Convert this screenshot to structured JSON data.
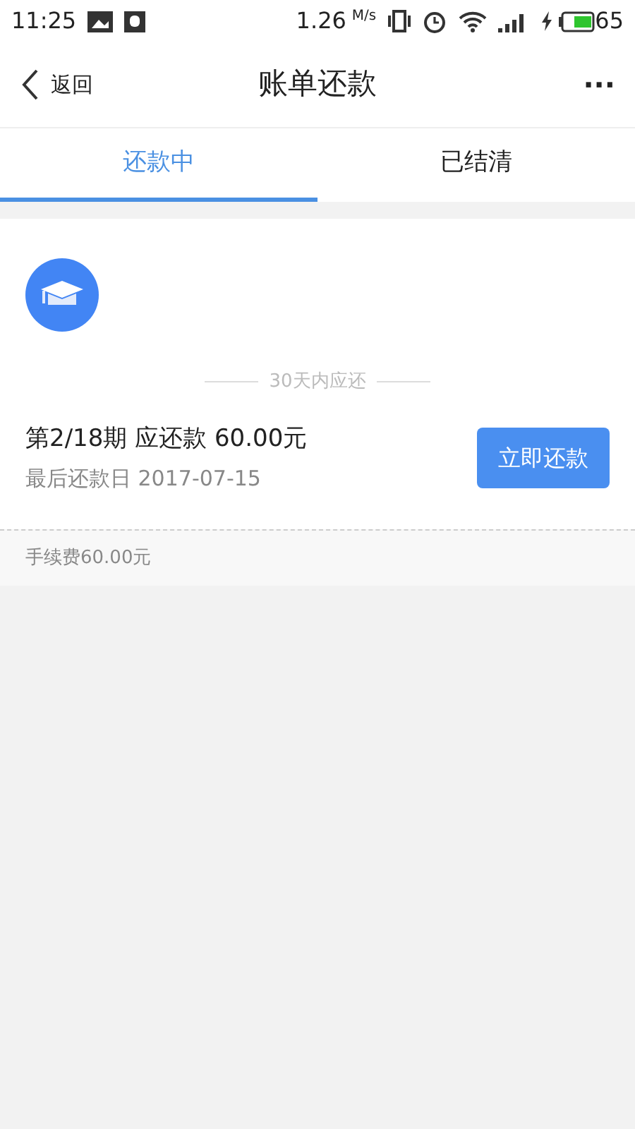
{
  "status_bar": {
    "time": "11:25",
    "speed": "1.26",
    "speed_unit": "M/s",
    "battery": "65"
  },
  "header": {
    "back": "返回",
    "title": "账单还款",
    "more": "···"
  },
  "tabs": [
    {
      "label": "还款中",
      "selected": true
    },
    {
      "label": "已结清",
      "selected": false
    }
  ],
  "bill": {
    "section": "30天内应还",
    "period": "第2/18期 应还款 60.00元",
    "due": "最后还款日 2017-07-15",
    "pay_button": "立即还款",
    "fee": "手续费60.00元"
  }
}
